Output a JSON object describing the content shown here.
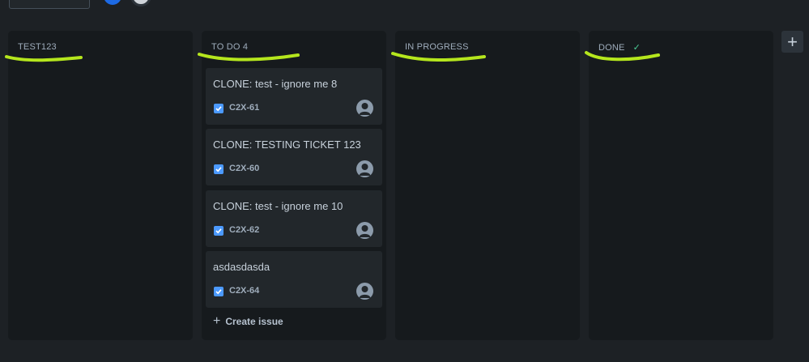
{
  "board": {
    "columns": [
      {
        "title": "TEST123",
        "done_check": ""
      },
      {
        "title": "TO DO 4",
        "done_check": ""
      },
      {
        "title": "IN PROGRESS",
        "done_check": ""
      },
      {
        "title": "DONE",
        "done_check": "✓"
      }
    ],
    "todo_cards": [
      {
        "title": "CLONE: test - ignore me 8",
        "key": "C2X-61"
      },
      {
        "title": "CLONE: TESTING TICKET 123",
        "key": "C2X-60"
      },
      {
        "title": "CLONE: test - ignore me 10",
        "key": "C2X-62"
      },
      {
        "title": "asdasdasda",
        "key": "C2X-64"
      }
    ],
    "create_issue_label": "Create issue",
    "create_issue_icon": "+",
    "add_column_icon": "+"
  },
  "colors": {
    "background": "#1d2125",
    "column": "#161a1d",
    "card": "#22272b",
    "highlight": "#b5e61d",
    "issue_type": "#4c9aff",
    "done_check": "#4bce97"
  }
}
